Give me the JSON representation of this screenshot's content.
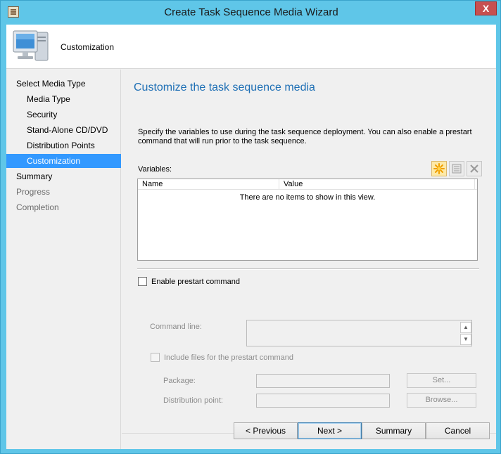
{
  "window": {
    "title": "Create Task Sequence Media Wizard",
    "close_glyph": "X",
    "title_icon": "wizard-app-icon",
    "accent_color": "#5fc6e8"
  },
  "header": {
    "title": "Customization",
    "icon": "computer-icon"
  },
  "nav": {
    "items": [
      {
        "label": "Select Media Type",
        "level": 0,
        "state": "normal"
      },
      {
        "label": "Media Type",
        "level": 1,
        "state": "normal"
      },
      {
        "label": "Security",
        "level": 1,
        "state": "normal"
      },
      {
        "label": "Stand-Alone CD/DVD",
        "level": 1,
        "state": "normal"
      },
      {
        "label": "Distribution Points",
        "level": 1,
        "state": "normal"
      },
      {
        "label": "Customization",
        "level": 1,
        "state": "active"
      },
      {
        "label": "Summary",
        "level": 0,
        "state": "normal"
      },
      {
        "label": "Progress",
        "level": 0,
        "state": "dim"
      },
      {
        "label": "Completion",
        "level": 0,
        "state": "dim"
      }
    ],
    "active_color": "#3399ff"
  },
  "main": {
    "title": "Customize the task sequence media",
    "description": "Specify the variables to use during the task sequence deployment. You can also enable a prestart command that will run prior to the task sequence.",
    "variables_label": "Variables:",
    "toolbar_icons": [
      "new-star-icon",
      "properties-icon",
      "delete-x-icon"
    ],
    "grid": {
      "columns": [
        "Name",
        "Value"
      ],
      "empty_text": "There are no items to show in this view."
    },
    "prestart": {
      "enable_label": "Enable prestart command",
      "enabled": false,
      "command_line_label": "Command line:",
      "command_line_value": "",
      "include_files_label": "Include files for the prestart command",
      "include_files": false,
      "package_label": "Package:",
      "package_value": "",
      "set_button": "Set...",
      "distribution_point_label": "Distribution point:",
      "distribution_point_value": "",
      "browse_button": "Browse..."
    }
  },
  "footer": {
    "previous": "< Previous",
    "next": "Next >",
    "summary": "Summary",
    "cancel": "Cancel"
  }
}
